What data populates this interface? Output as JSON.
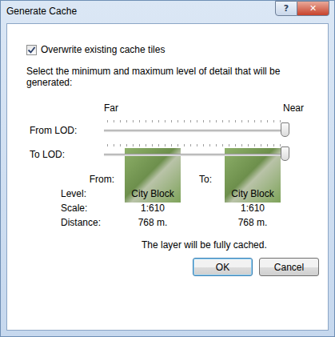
{
  "window": {
    "title": "Generate Cache",
    "controls": [
      "?",
      "✕"
    ]
  },
  "overwrite": {
    "label": "Overwrite existing cache tiles",
    "checked": true
  },
  "instruction": "Select the minimum and maximum level of detail that will be generated:",
  "scale_labels": {
    "far": "Far",
    "near": "Near"
  },
  "sliders": [
    {
      "label": "From LOD:",
      "level": 1
    },
    {
      "label": "To LOD:",
      "level": 1
    }
  ],
  "previews": [
    {
      "label": "From:",
      "level": "City Block",
      "scale": "1:610",
      "distance": "768 m."
    },
    {
      "label": "To:",
      "level": "City Block",
      "scale": "1:610",
      "distance": "768 m."
    }
  ],
  "row_labels": [
    "Level:",
    "Scale:",
    "Distance:"
  ],
  "status": "The layer will be fully cached.",
  "buttons": [
    {
      "label": "OK",
      "default": true
    },
    {
      "label": "Cancel",
      "default": false
    }
  ]
}
